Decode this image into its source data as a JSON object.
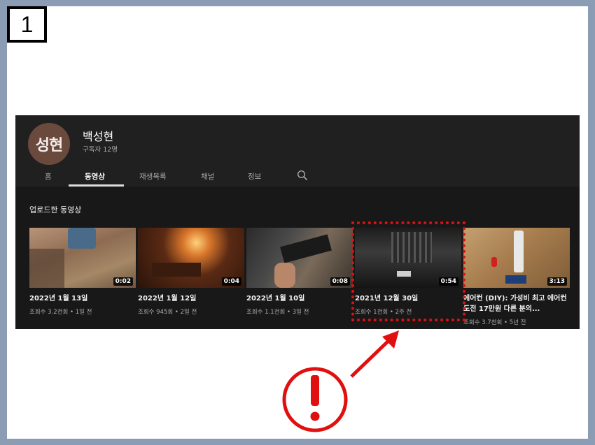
{
  "slide": {
    "number": "1"
  },
  "channel": {
    "avatar_text": "성현",
    "name": "백성현",
    "subscribers": "구독자 12명"
  },
  "tabs": [
    {
      "label": "홈",
      "active": false
    },
    {
      "label": "동영상",
      "active": true
    },
    {
      "label": "재생목록",
      "active": false
    },
    {
      "label": "채널",
      "active": false
    },
    {
      "label": "정보",
      "active": false
    }
  ],
  "section": {
    "title": "업로드한 동영상"
  },
  "videos": [
    {
      "title": "2022년 1월 13일",
      "meta": "조회수 3.2천회 • 1일 전",
      "duration": "0:02"
    },
    {
      "title": "2022년 1월 12일",
      "meta": "조회수 945회 • 2일 전",
      "duration": "0:04"
    },
    {
      "title": "2022년 1월 10일",
      "meta": "조회수 1.1천회 • 3일 전",
      "duration": "0:08"
    },
    {
      "title": "2021년 12월 30일",
      "meta": "조회수 1천회 • 2주 전",
      "duration": "0:54"
    },
    {
      "title": "에어컨 (DIY): 가성비 최고 에어컨 도전 17만원 다른 분의...",
      "meta": "조회수 3.7천회 • 5년 전",
      "duration": "3:13"
    }
  ],
  "colors": {
    "highlight": "#e01010",
    "background": "#8a9db5",
    "panel": "#181818"
  },
  "icons": {
    "search": "search-icon",
    "alert": "exclamation-circle-icon"
  }
}
